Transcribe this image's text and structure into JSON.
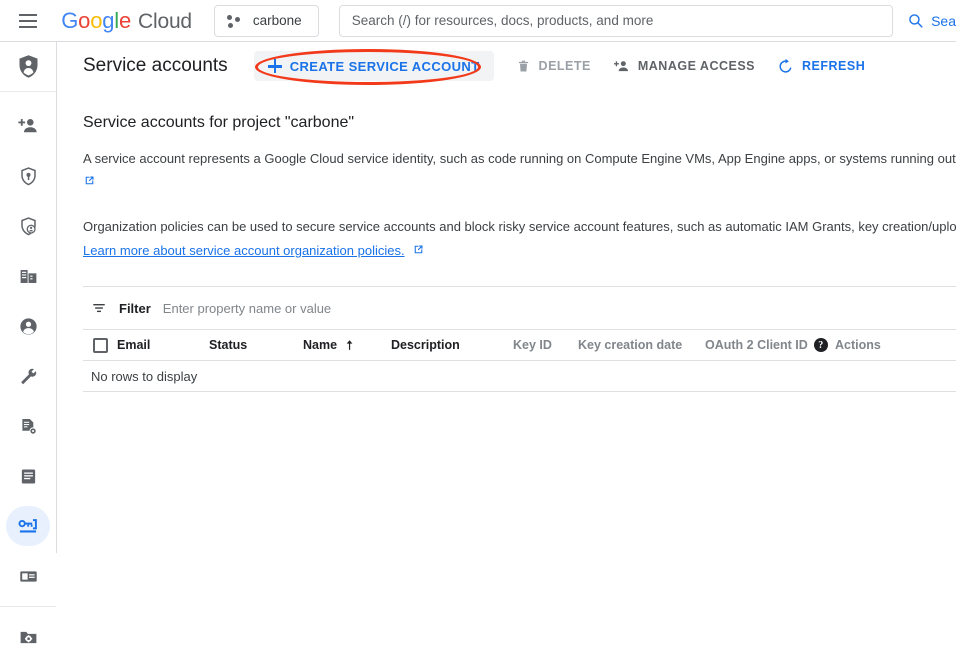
{
  "topbar": {
    "menu_icon": "hamburger-icon",
    "logo": {
      "g1": "G",
      "g2": "o",
      "g3": "o",
      "g4": "g",
      "g5": "l",
      "g6": "e",
      "cloud": "Cloud"
    },
    "project_chip": {
      "label": "carbone",
      "icon": "project-dots-icon"
    },
    "search": {
      "placeholder": "Search (/) for resources, docs, products, and more",
      "value": "",
      "button_label": "Sea",
      "button_icon": "search-icon"
    }
  },
  "sidebar": {
    "header_icon": "iam-shield-person-icon",
    "items": [
      {
        "icon": "add-person-icon",
        "selected": false
      },
      {
        "icon": "shield-key-icon",
        "selected": false
      },
      {
        "icon": "shield-person-icon",
        "selected": false
      },
      {
        "icon": "organization-card-icon",
        "selected": false
      },
      {
        "icon": "account-circle-icon",
        "selected": false
      },
      {
        "icon": "wrench-icon",
        "selected": false
      },
      {
        "icon": "document-settings-icon",
        "selected": false
      },
      {
        "icon": "list-document-icon",
        "selected": false
      },
      {
        "icon": "service-account-key-icon",
        "selected": true
      },
      {
        "icon": "id-card-icon",
        "selected": false
      },
      {
        "icon": "folder-settings-icon",
        "selected": false
      }
    ]
  },
  "page": {
    "title": "Service accounts",
    "toolbar": {
      "create_label": "CREATE SERVICE ACCOUNT",
      "delete_label": "DELETE",
      "manage_access_label": "MANAGE ACCESS",
      "refresh_label": "REFRESH"
    },
    "annotation": {
      "target": "CREATE SERVICE ACCOUNT",
      "color": "#f23a1b"
    },
    "heading": "Service accounts for project \"carbone\"",
    "paragraph1": "A service account represents a Google Cloud service identity, such as code running on Compute Engine VMs, App Engine apps, or systems running outsi",
    "paragraph2": "Organization policies can be used to secure service accounts and block risky service account features, such as automatic IAM Grants, key creation/uplo",
    "learn_more_link": "Learn more about service account organization policies."
  },
  "filter": {
    "label": "Filter",
    "placeholder": "Enter property name or value",
    "value": "",
    "icon": "filter-icon"
  },
  "table": {
    "columns": [
      {
        "label": "Email",
        "tone": "dark"
      },
      {
        "label": "Status",
        "tone": "dark"
      },
      {
        "label": "Name",
        "tone": "dark",
        "sort": "ascending"
      },
      {
        "label": "Description",
        "tone": "dark"
      },
      {
        "label": "Key ID",
        "tone": "light"
      },
      {
        "label": "Key creation date",
        "tone": "light"
      },
      {
        "label": "OAuth 2 Client ID",
        "tone": "light",
        "help": true
      },
      {
        "label": "Actions",
        "tone": "light"
      }
    ],
    "empty_message": "No rows to display",
    "rows": []
  },
  "colors": {
    "accent_blue": "#1a73e8",
    "selected_bg": "#e8f0fe",
    "annotation_red": "#f23a1b",
    "gray_text": "#5f6368",
    "light_gray_text": "#80868b"
  }
}
